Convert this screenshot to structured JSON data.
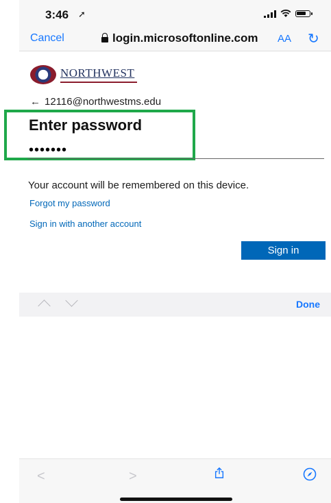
{
  "status": {
    "time": "3:46"
  },
  "browser": {
    "cancel_label": "Cancel",
    "url": "login.microsoftonline.com",
    "text_size_label": "AA"
  },
  "logo": {
    "name": "NORTHWEST"
  },
  "account": {
    "email": "12116@northwestms.edu"
  },
  "form": {
    "title": "Enter password",
    "password_value": "•••••••",
    "remember_text": "Your account will be remembered on this device.",
    "forgot_link": "Forgot my password",
    "another_account_link": "Sign in with another account",
    "sign_in_label": "Sign in"
  },
  "keyboard_bar": {
    "done_label": "Done"
  },
  "colors": {
    "accent": "#0067b8",
    "ios_blue": "#1677ff",
    "highlight": "#1fa84a"
  }
}
